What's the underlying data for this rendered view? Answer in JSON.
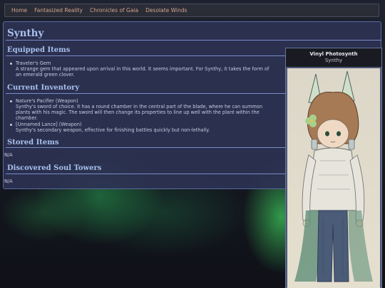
{
  "nav": {
    "items": [
      "Home",
      "Fantasized Reality",
      "Chronicles of Gaia",
      "Desolate Winds"
    ]
  },
  "page": {
    "title": "Synthy"
  },
  "sections": {
    "equipped": {
      "heading": "Equipped Items",
      "items": [
        {
          "name": "Traveler's Gem",
          "desc_line1": "A strange gem that appeared upon arrival in this world. It seems important. For Synthy, it takes the form of",
          "desc_line2": "an emerald green clover."
        }
      ]
    },
    "inventory": {
      "heading": "Current Inventory",
      "items": [
        {
          "name": "Nature's Pacifier (Weapon)",
          "desc_line1": "Synthy's sword of choice. It has a round chamber in the central part of the blade, where he can summon",
          "desc_line2": "plants with his magic. The sword will then change its properties to line up well with the plant within the",
          "desc_line3": "chamber."
        },
        {
          "name": "[Unnamed Lance] (Weapon)",
          "desc_line1": "Synthy's secondary weapon, effective for finishing battles quickly but non-lethally."
        }
      ]
    },
    "stored": {
      "heading": "Stored Items",
      "value": "N/A"
    },
    "towers": {
      "heading": "Discovered Soul Towers",
      "value": "N/A"
    }
  },
  "sidebar": {
    "image_title": "Vinyl Photosynth",
    "image_subtitle": "Synthy",
    "art_alt": "drawing of Synthy"
  },
  "colors": {
    "nav_link": "#d3a58f",
    "heading": "#a9c0ec",
    "panel": "#2c3252",
    "text": "#c8cde0"
  }
}
